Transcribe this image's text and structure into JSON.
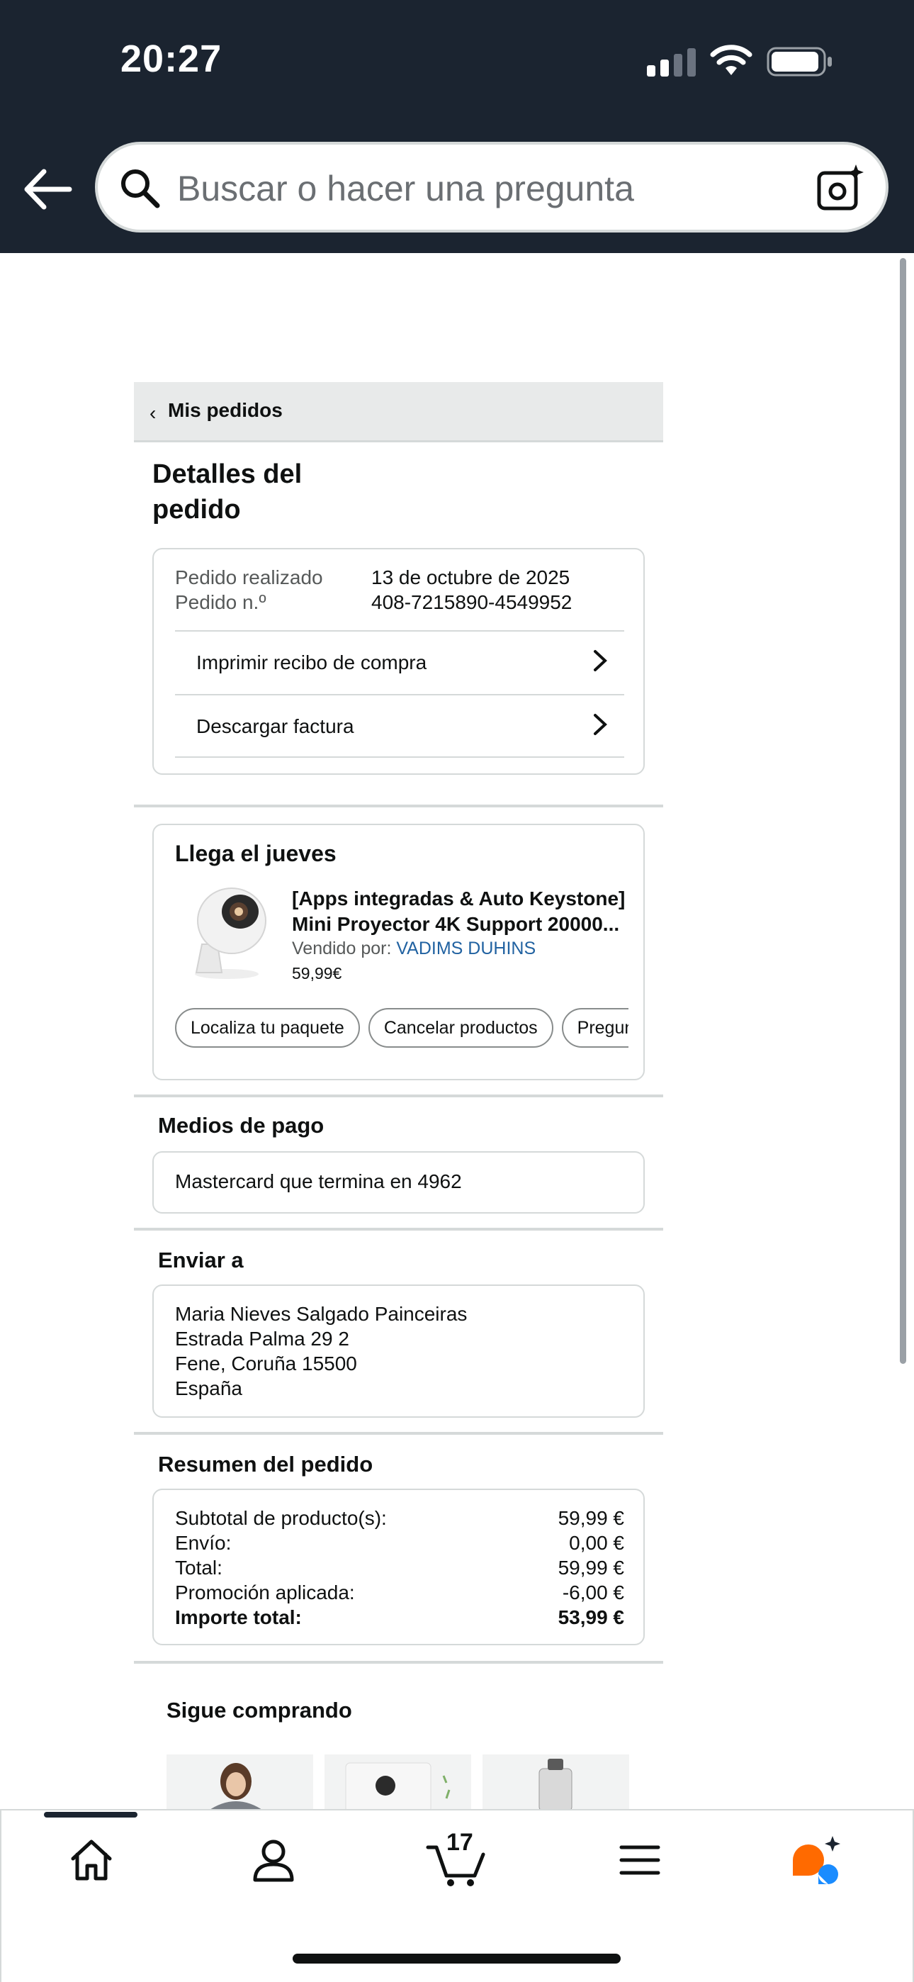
{
  "status_bar": {
    "time": "20:27"
  },
  "search": {
    "placeholder": "Buscar o hacer una pregunta"
  },
  "breadcrumb": {
    "label": "Mis pedidos"
  },
  "page_title": "Detalles del pedido",
  "order_info": {
    "placed_label": "Pedido realizado",
    "placed_value": "13 de octubre de 2025",
    "number_label": "Pedido n.º",
    "number_value": "408-7215890-4549952",
    "links": [
      "Imprimir recibo de compra",
      "Descargar factura"
    ]
  },
  "shipment": {
    "heading": "Llega el jueves",
    "product_title_line1": "[Apps integradas & Auto Keystone]",
    "product_title_line2": "Mini Proyector 4K Support 20000...",
    "sold_by_label": "Vendido por:",
    "seller": "VADIMS DUHINS",
    "price": "59,99€",
    "actions": [
      "Localiza tu paquete",
      "Cancelar productos",
      "Pregunta"
    ]
  },
  "payment": {
    "heading": "Medios de pago",
    "method": "Mastercard  que termina en 4962"
  },
  "shipping": {
    "heading": "Enviar a",
    "name": "Maria Nieves Salgado Painceiras",
    "street": "Estrada Palma 29 2",
    "city": "Fene, Coruña 15500",
    "country": "España"
  },
  "summary": {
    "heading": "Resumen del pedido",
    "rows": [
      {
        "label": "Subtotal de producto(s):",
        "value": "59,99 €"
      },
      {
        "label": "Envío:",
        "value": "0,00 €"
      },
      {
        "label": "Total:",
        "value": "59,99 €"
      },
      {
        "label": "Promoción aplicada:",
        "value": "-6,00 €"
      },
      {
        "label": "Importe total:",
        "value": "53,99 €"
      }
    ]
  },
  "keep_shopping": {
    "heading": "Sigue comprando"
  },
  "tabbar": {
    "cart_count": "17",
    "tabs": [
      "home-icon",
      "account-icon",
      "cart-icon",
      "menu-icon",
      "rufus-icon"
    ]
  },
  "colors": {
    "header_bg": "#1b2430",
    "link": "#2162a1",
    "accent_orange": "#ff6a00",
    "accent_blue": "#1a8cff"
  }
}
